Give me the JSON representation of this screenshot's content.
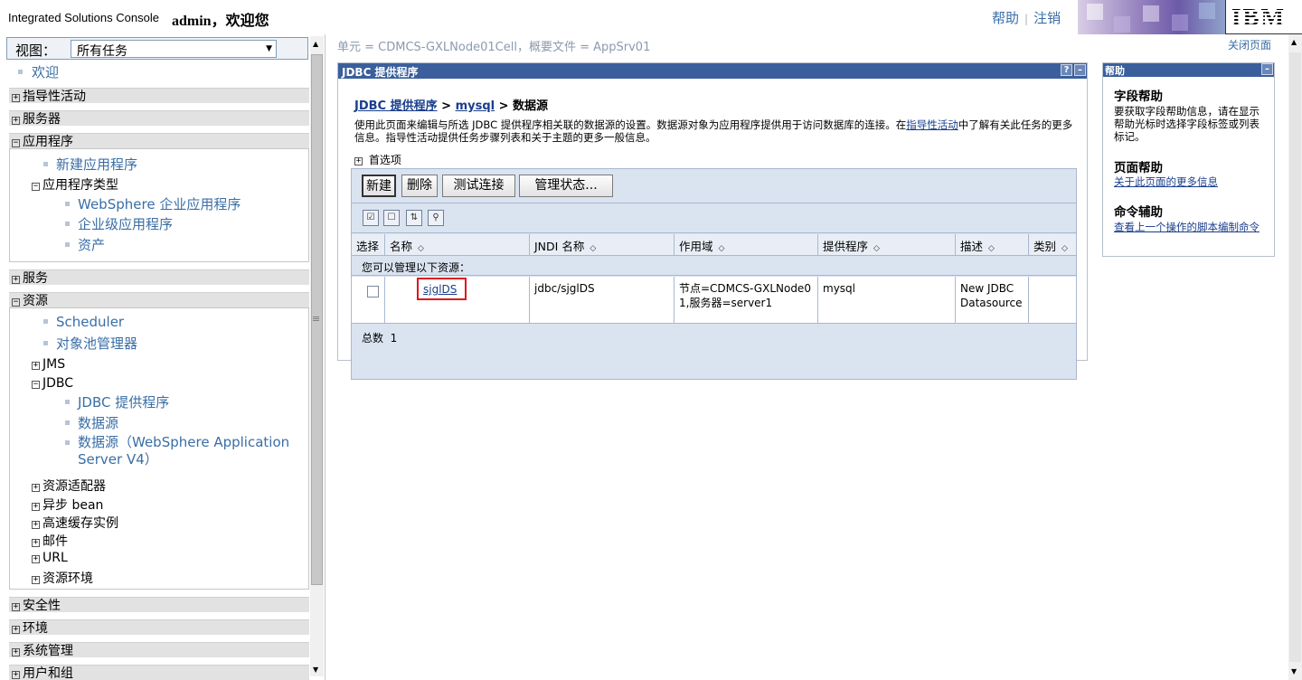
{
  "header": {
    "title": "Integrated Solutions Console",
    "welcome": "admin，欢迎您",
    "help": "帮助",
    "sep": "|",
    "logout": "注销",
    "logo": "IBM"
  },
  "nav": {
    "view_label": "视图：",
    "view_value": "所有任务",
    "welcome": "欢迎",
    "sections": [
      "指导性活动",
      "服务器",
      "应用程序",
      "服务",
      "资源",
      "安全性",
      "环境",
      "系统管理",
      "用户和组"
    ],
    "app": {
      "new_app": "新建应用程序",
      "types": "应用程序类型",
      "items": [
        "WebSphere 企业应用程序",
        "企业级应用程序",
        "资产"
      ]
    },
    "res": {
      "scheduler": "Scheduler",
      "pool": "对象池管理器",
      "jms": "JMS",
      "jdbc": "JDBC",
      "jdbc_items": [
        "JDBC 提供程序",
        "数据源",
        "数据源（WebSphere Application Server V4）"
      ],
      "more": [
        "资源适配器",
        "异步 bean",
        "高速缓存实例",
        "邮件",
        "URL",
        "资源环境"
      ]
    }
  },
  "main": {
    "scope": "单元 = CDMCS-GXLNode01Cell，概要文件 = AppSrv01",
    "close_page": "关闭页面",
    "panel_title": "JDBC 提供程序",
    "q": "?",
    "min": "–",
    "breadcrumb": {
      "l1": "JDBC 提供程序",
      "sep1": " > ",
      "l2": "mysql",
      "sep2": " > ",
      "cur": "数据源"
    },
    "desc1": "使用此页面来编辑与所选 JDBC 提供程序相关联的数据源的设置。数据源对象为应用程序提供用于访问数据库的连接。在",
    "desc_link": "指导性活动",
    "desc2": "中了解有关此任务的更多信息。指导性活动提供任务步骤列表和关于主题的更多一般信息。",
    "prefs": "首选项",
    "buttons": [
      "新建",
      "删除",
      "测试连接",
      "管理状态..."
    ],
    "columns": [
      "选择",
      "名称",
      "JNDI 名称",
      "作用域",
      "提供程序",
      "描述",
      "类别"
    ],
    "info": "您可以管理以下资源：",
    "row": {
      "name": "sjglDS",
      "jndi": "jdbc/sjglDS",
      "scope": "节点=CDMCS-GXLNode01,服务器=server1",
      "provider": "mysql",
      "desc": "New JDBC Datasource",
      "category": ""
    },
    "total_label": "总数",
    "total": "1"
  },
  "help": {
    "title": "帮助",
    "field_h": "字段帮助",
    "field_t": "要获取字段帮助信息，请在显示帮助光标时选择字段标签或列表标记。",
    "page_h": "页面帮助",
    "page_link": "关于此页面的更多信息",
    "cmd_h": "命令辅助",
    "cmd_link": "查看上一个操作的脚本编制命令"
  }
}
